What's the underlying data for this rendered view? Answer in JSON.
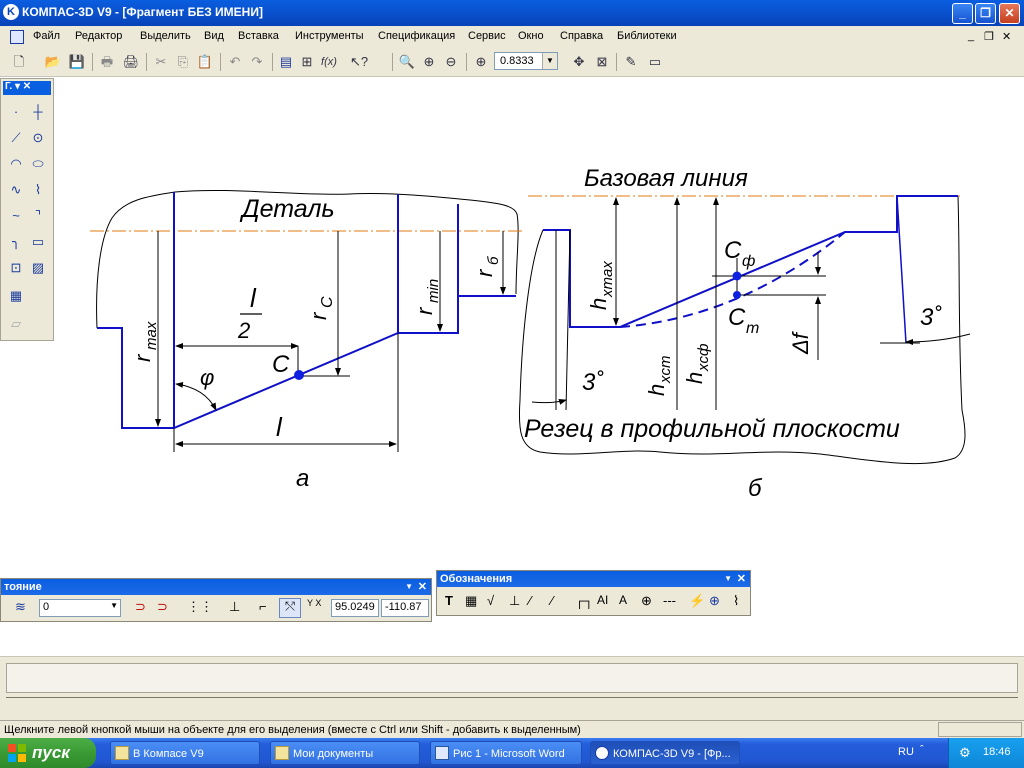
{
  "window": {
    "app_icon": "kompas-logo-icon",
    "title": "КОМПАС-3D V9 - [Фрагмент БЕЗ ИМЕНИ]",
    "buttons": [
      "_",
      "❐",
      "✕"
    ]
  },
  "menu": {
    "items": [
      "Файл",
      "Редактор",
      "Выделить",
      "Вид",
      "Вставка",
      "Инструменты",
      "Спецификация",
      "Сервис",
      "Окно",
      "Справка",
      "Библиотеки"
    ],
    "doc_controls": [
      "_",
      "❐",
      "✕"
    ]
  },
  "toolbar": {
    "zoom_value": "0.8333",
    "icons": [
      "new-doc-icon",
      "open-folder-icon",
      "save-icon",
      "print-icon",
      "print-preview-icon",
      "cut-icon",
      "copy-icon",
      "paste-icon",
      "undo-icon",
      "redo-icon",
      "manager-icon",
      "properties-icon",
      "function-icon",
      "help-pointer-icon",
      "zoom-in-window-icon",
      "zoom-in-icon",
      "zoom-out-icon",
      "zoom-scale-icon",
      "pan-icon",
      "fit-all-icon",
      "refresh-icon",
      "layer-icon"
    ]
  },
  "left_panel": {
    "title": "Г.",
    "tools": [
      "point-icon",
      "aux-line-icon",
      "segment-icon",
      "circle-icon",
      "arc-icon",
      "ellipse-icon",
      "bezier-icon",
      "polyline-icon",
      "spline-icon",
      "chamfer-icon",
      "fillet-icon",
      "rectangle-icon",
      "contour-icon",
      "hatch-icon",
      "macro-icon",
      "disabled-tool-icon"
    ]
  },
  "drawing": {
    "left": {
      "label_part": "Деталь",
      "label_rmax_main": "r",
      "label_rmax_sub": "max",
      "label_half_l_num": "l",
      "label_half_l_den": "2",
      "label_rc_main": "r",
      "label_rc_sub": "C",
      "label_rmin_main": "r",
      "label_rmin_sub": "min",
      "label_rb_main": "r",
      "label_rb_sub": "б",
      "label_point": "C",
      "label_phi": "φ",
      "label_l": "l",
      "caption": "а"
    },
    "right": {
      "label_base": "Базовая линия",
      "label_hxmax_main": "h",
      "label_hxmax_sub": "xmax",
      "label_cf_main": "C",
      "label_cf_sub": "ф",
      "label_ct_main": "C",
      "label_ct_sub": "т",
      "label_hxct_main": "h",
      "label_hxct_sub": "xcт",
      "label_hxcf_main": "h",
      "label_hxcf_sub": "xcф",
      "label_delta": "Δf",
      "label_angle_left": "3˚",
      "label_angle_right": "3˚",
      "label_cutter": "Резец в профильной плоскости",
      "caption": "б"
    },
    "colors": {
      "profile": "#1010c8",
      "dimension": "#000000",
      "axis": "#e07a10",
      "point": "#1020e0"
    }
  },
  "state_panel": {
    "title": "тояние",
    "layer_value": "0",
    "coord_x": "95.0249",
    "coord_y": "-110.87",
    "coord_icon_label": "Y X"
  },
  "marks_panel": {
    "title": "Обозначения",
    "icons": [
      "text-icon",
      "table-icon",
      "roughness-icon",
      "base-icon",
      "position-icon",
      "leader-icon",
      "arrow-icon",
      "cut-line-icon",
      "view-arrow-icon",
      "tolerance-icon",
      "axis-line-icon",
      "break-icon",
      "center-mark-icon",
      "wave-line-icon"
    ]
  },
  "status": {
    "hint": "Щелкните левой кнопкой мыши на объекте для его выделения (вместе с Ctrl или Shift - добавить к выделенным)"
  },
  "taskbar": {
    "start_label": "пуск",
    "tasks": [
      "В Компасе V9",
      "Мои документы",
      "Рис 1 - Microsoft Word",
      "КОМПАС-3D V9 - [Фр..."
    ],
    "lang": "RU",
    "clock": "18:46"
  }
}
